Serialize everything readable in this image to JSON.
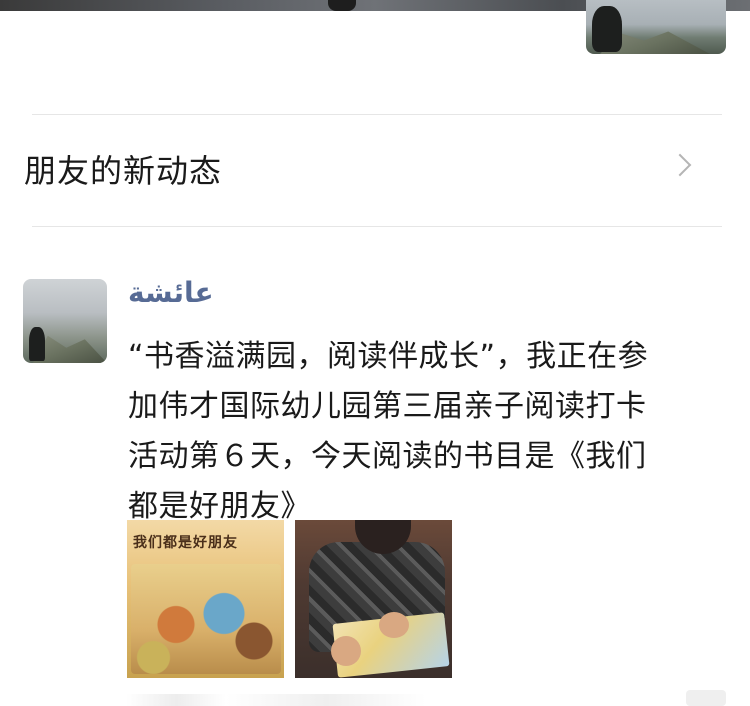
{
  "feed_header": {
    "friends_updates_label": "朋友的新动态"
  },
  "post": {
    "author": "عائشة",
    "text_lines": [
      "“书香溢满园，阅读伴成长”，我正在参",
      "加伟才国际幼儿园第三届亲子阅读打卡",
      "活动第６天，今天阅读的书目是《我们",
      "都是好朋友》"
    ],
    "images": [
      {
        "title": "我们都是好朋友"
      },
      {}
    ]
  },
  "icons": {
    "row_chevron": "chevron-right-icon"
  }
}
